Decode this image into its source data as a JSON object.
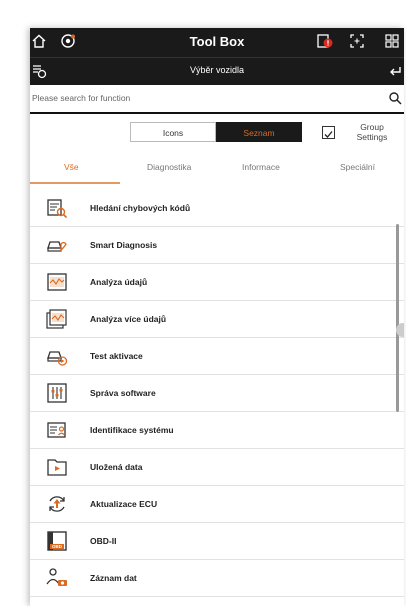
{
  "header": {
    "title": "Tool Box"
  },
  "subheader": {
    "title": "Výběr vozidla"
  },
  "search": {
    "placeholder": "Please search for function"
  },
  "view_toggle": {
    "icons_label": "Icons",
    "list_label": "Seznam"
  },
  "group_settings": {
    "label_line1": "Group",
    "label_line2": "Settings",
    "checked": true
  },
  "tabs": [
    {
      "label": "Vše",
      "active": true
    },
    {
      "label": "Diagnostika",
      "active": false
    },
    {
      "label": "Informace",
      "active": false
    },
    {
      "label": "Speciální",
      "active": false
    }
  ],
  "functions": [
    {
      "label": "Hledání chybových kódů",
      "icon": "dtc-search-icon"
    },
    {
      "label": "Smart Diagnosis",
      "icon": "smart-diagnosis-icon"
    },
    {
      "label": "Analýza údajů",
      "icon": "data-analysis-icon"
    },
    {
      "label": "Analýza více údajů",
      "icon": "multi-data-analysis-icon"
    },
    {
      "label": "Test aktivace",
      "icon": "activation-test-icon"
    },
    {
      "label": "Správa software",
      "icon": "software-management-icon"
    },
    {
      "label": "Identifikace systému",
      "icon": "system-identification-icon"
    },
    {
      "label": "Uložená data",
      "icon": "saved-data-icon"
    },
    {
      "label": "Aktualizace ECU",
      "icon": "ecu-update-icon"
    },
    {
      "label": "OBD-II",
      "icon": "obd-icon",
      "icon_text": "OBD"
    },
    {
      "label": "Záznam dat",
      "icon": "data-record-icon"
    }
  ],
  "colors": {
    "accent": "#d96c22",
    "bar": "#1a1a1a"
  }
}
